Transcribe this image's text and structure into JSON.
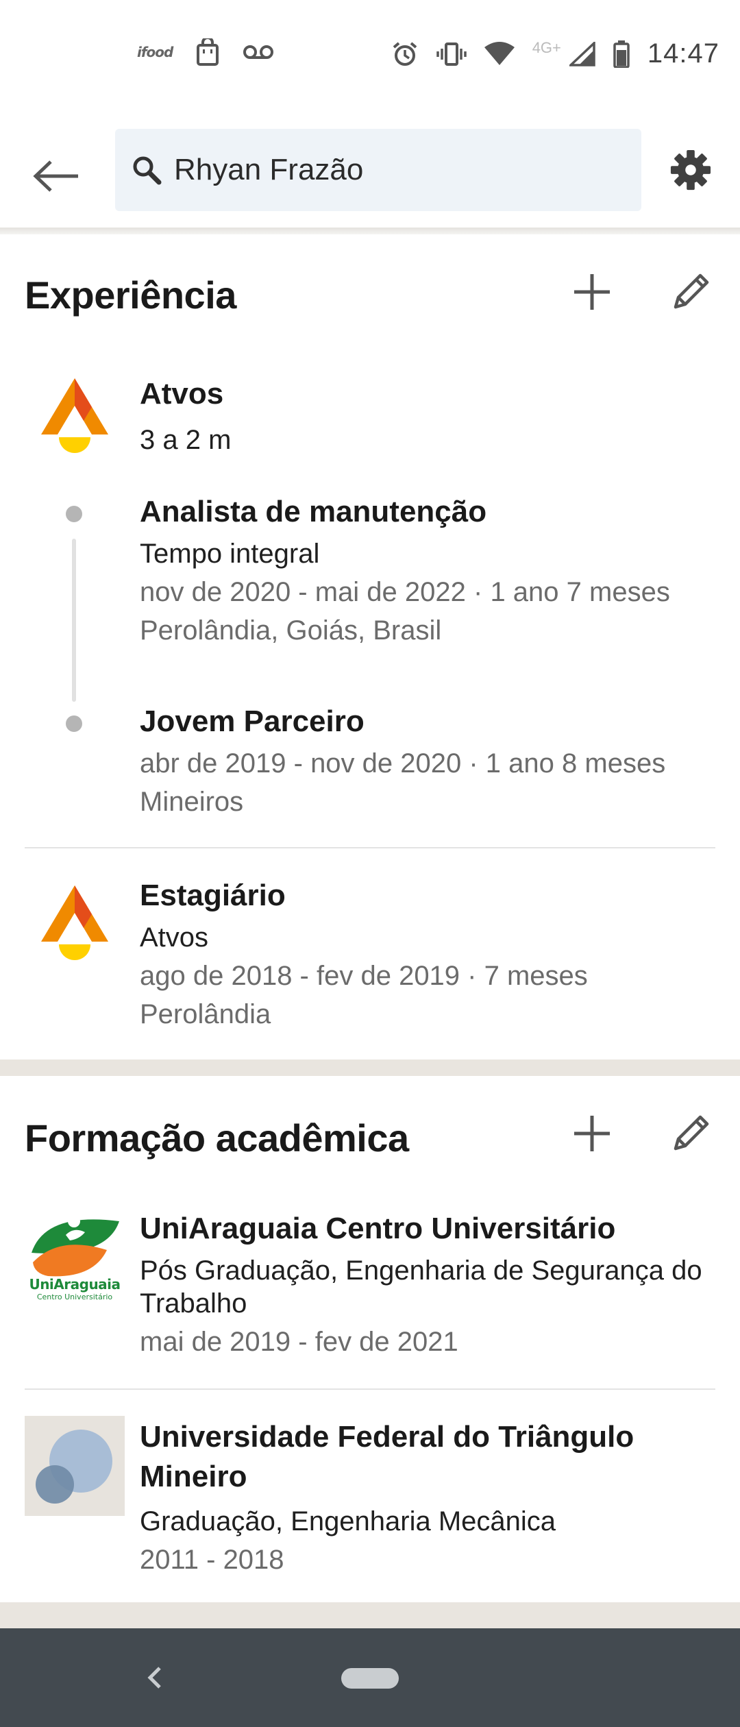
{
  "status_bar": {
    "app_notif_label": "ifood",
    "time": "14:47",
    "network": "4G+",
    "icons": [
      "ifood-icon",
      "shopping-bag-icon",
      "voicemail-icon",
      "alarm-icon",
      "vibrate-icon",
      "wifi-icon",
      "signal-icon",
      "battery-icon"
    ]
  },
  "header": {
    "search_value": "Rhyan Frazão",
    "icons": [
      "back-arrow-icon",
      "search-icon",
      "gear-icon"
    ]
  },
  "experience": {
    "title": "Experiência",
    "company": {
      "name": "Atvos",
      "duration": "3 a 2 m",
      "roles": [
        {
          "title": "Analista de manutenção",
          "type": "Tempo integral",
          "dates": "nov de 2020 - mai de 2022 · 1 ano 7 meses",
          "location": "Perolândia, Goiás, Brasil"
        },
        {
          "title": "Jovem Parceiro",
          "dates": "abr de 2019 - nov de 2020 · 1 ano 8 meses",
          "location": "Mineiros"
        }
      ]
    },
    "second": {
      "title": "Estagiário",
      "company": "Atvos",
      "dates": "ago de 2018 - fev de 2019 · 7 meses",
      "location": "Perolândia"
    }
  },
  "education": {
    "title": "Formação acadêmica",
    "items": [
      {
        "school": "UniAraguaia Centro Universitário",
        "degree_line1": "Pós Graduação, Engenharia de Segurança do",
        "degree_line2": "Trabalho",
        "dates": "mai de 2019 - fev de 2021",
        "logo_text": "UniAraguaia",
        "logo_subtext": "Centro Universitário"
      },
      {
        "school_line1": "Universidade Federal do Triângulo",
        "school_line2": "Mineiro",
        "degree": "Graduação, Engenharia Mecânica",
        "dates": "2011 - 2018"
      }
    ]
  },
  "colors": {
    "search_bg": "#eef3f8",
    "section_gap": "#e9e5df",
    "nav_bar": "#434a50",
    "atvos_orange": "#f08a00",
    "atvos_yellow": "#ffd000",
    "uni_green": "#1e8a3a",
    "uni_orange": "#f07a22"
  }
}
